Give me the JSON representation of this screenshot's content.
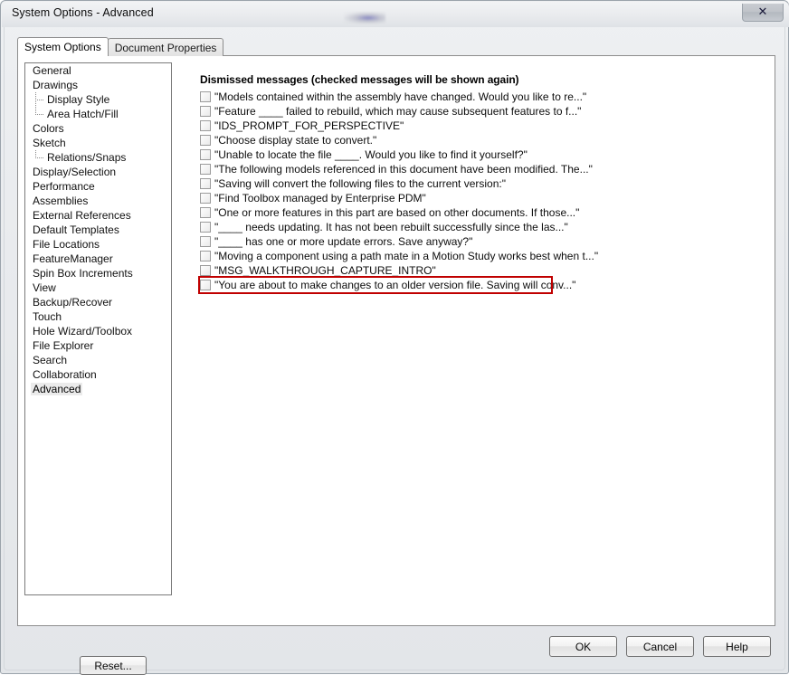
{
  "window": {
    "title": "System Options - Advanced",
    "close_icon": "close-x-icon",
    "close_glyph": "✕"
  },
  "tabs": [
    {
      "label": "System Options",
      "active": true
    },
    {
      "label": "Document Properties",
      "active": false
    }
  ],
  "sidebar": {
    "items": [
      {
        "label": "General",
        "child": false,
        "selected": false
      },
      {
        "label": "Drawings",
        "child": false,
        "selected": false
      },
      {
        "label": "Display Style",
        "child": true,
        "selected": false,
        "last": false
      },
      {
        "label": "Area Hatch/Fill",
        "child": true,
        "selected": false,
        "last": true
      },
      {
        "label": "Colors",
        "child": false,
        "selected": false
      },
      {
        "label": "Sketch",
        "child": false,
        "selected": false
      },
      {
        "label": "Relations/Snaps",
        "child": true,
        "selected": false,
        "last": true
      },
      {
        "label": "Display/Selection",
        "child": false,
        "selected": false
      },
      {
        "label": "Performance",
        "child": false,
        "selected": false
      },
      {
        "label": "Assemblies",
        "child": false,
        "selected": false
      },
      {
        "label": "External References",
        "child": false,
        "selected": false
      },
      {
        "label": "Default Templates",
        "child": false,
        "selected": false
      },
      {
        "label": "File Locations",
        "child": false,
        "selected": false
      },
      {
        "label": "FeatureManager",
        "child": false,
        "selected": false
      },
      {
        "label": "Spin Box Increments",
        "child": false,
        "selected": false
      },
      {
        "label": "View",
        "child": false,
        "selected": false
      },
      {
        "label": "Backup/Recover",
        "child": false,
        "selected": false
      },
      {
        "label": "Touch",
        "child": false,
        "selected": false
      },
      {
        "label": "Hole Wizard/Toolbox",
        "child": false,
        "selected": false
      },
      {
        "label": "File Explorer",
        "child": false,
        "selected": false
      },
      {
        "label": "Search",
        "child": false,
        "selected": false
      },
      {
        "label": "Collaboration",
        "child": false,
        "selected": false
      },
      {
        "label": "Advanced",
        "child": false,
        "selected": true
      }
    ],
    "reset_label": "Reset..."
  },
  "main": {
    "heading": "Dismissed messages (checked messages will be shown again)",
    "highlight_color": "#c00000",
    "messages": [
      {
        "text": "\"Models contained within the assembly have changed.  Would you like to re...\"",
        "checked": false,
        "highlighted": false
      },
      {
        "text": "\"Feature ____ failed to rebuild, which may cause subsequent features to f...\"",
        "checked": false,
        "highlighted": false
      },
      {
        "text": "\"IDS_PROMPT_FOR_PERSPECTIVE\"",
        "checked": false,
        "highlighted": false
      },
      {
        "text": "\"Choose display state to convert.\"",
        "checked": false,
        "highlighted": false
      },
      {
        "text": "\"Unable to locate the file ____.  Would you like to find it yourself?\"",
        "checked": false,
        "highlighted": false
      },
      {
        "text": "\"The following models referenced in this document have been modified. The...\"",
        "checked": false,
        "highlighted": false
      },
      {
        "text": "\"Saving will convert the following files to the current version:\"",
        "checked": false,
        "highlighted": false
      },
      {
        "text": "\"Find Toolbox managed by Enterprise PDM\"",
        "checked": false,
        "highlighted": false
      },
      {
        "text": "\"One or more features in this part are based on other documents. If those...\"",
        "checked": false,
        "highlighted": false
      },
      {
        "text": "\"____ needs updating.  It has not been rebuilt successfully since the las...\"",
        "checked": false,
        "highlighted": false
      },
      {
        "text": "\"____ has one or more update errors.  Save anyway?\"",
        "checked": false,
        "highlighted": false
      },
      {
        "text": "\"Moving a component using a path mate in a Motion Study works best when t...\"",
        "checked": false,
        "highlighted": false
      },
      {
        "text": "\"MSG_WALKTHROUGH_CAPTURE_INTRO\"",
        "checked": false,
        "highlighted": false
      },
      {
        "text": "\"You are about to make changes to an older version file. Saving will conv...\"",
        "checked": false,
        "highlighted": true
      }
    ]
  },
  "footer": {
    "ok_label": "OK",
    "cancel_label": "Cancel",
    "help_label": "Help"
  }
}
